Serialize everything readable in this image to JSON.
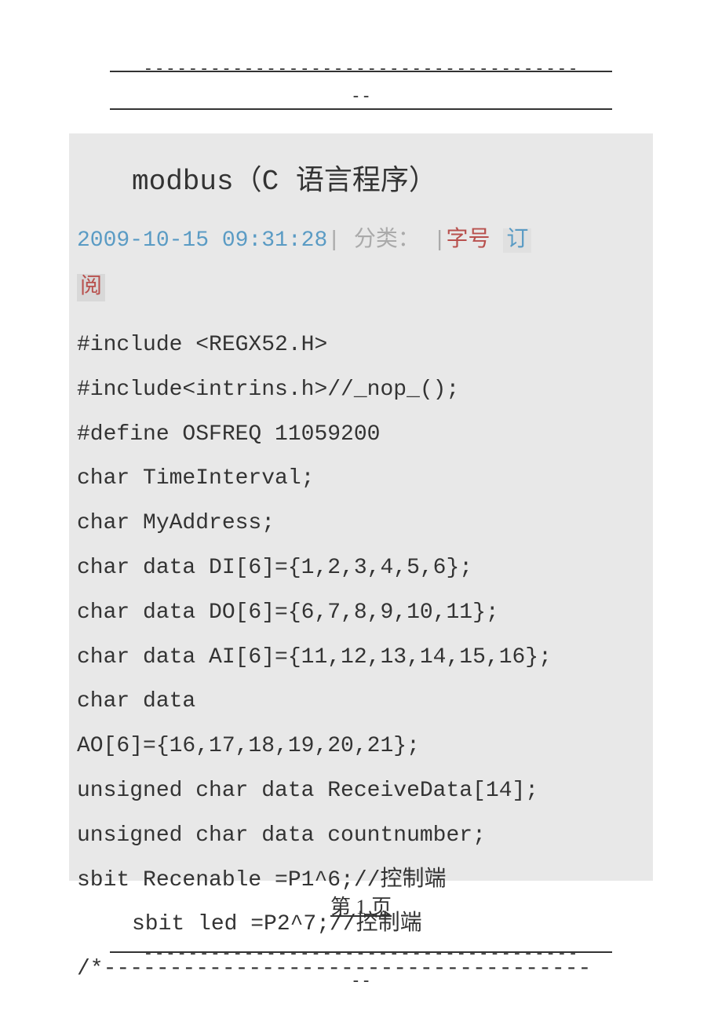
{
  "separator_top": "---------------------------------------",
  "separator_mid": "--",
  "title": "modbus（C 语言程序）",
  "meta": {
    "date": "2009-10-15 09:31:28",
    "pipe1": "|",
    "category_label": "分类：",
    "pipe2": "|",
    "font_label": "字号",
    "subscribe": "订",
    "read": "阅"
  },
  "code": {
    "line1": "#include <REGX52.H>",
    "line2": "#include<intrins.h>//_nop_();",
    "line3": "#define   OSFREQ 11059200",
    "line4": "char TimeInterval;",
    "line5": "char MyAddress;",
    "line6": "char data DI[6]={1,2,3,4,5,6};",
    "line7": "char data DO[6]={6,7,8,9,10,11};",
    "line8": "char data AI[6]={11,12,13,14,15,16};",
    "line9": "char data",
    "line10": "AO[6]={16,17,18,19,20,21};",
    "line11": "unsigned char data ReceiveData[14];",
    "line12": "unsigned char data   countnumber;",
    "line13": "sbit Recenable   =P1^6;//控制端",
    "line14": "sbit led   =P2^7;//控制端",
    "line15": "/*-------------------------------------"
  },
  "page_number": "第 1 页",
  "separator_bottom": "---------------------------------------"
}
